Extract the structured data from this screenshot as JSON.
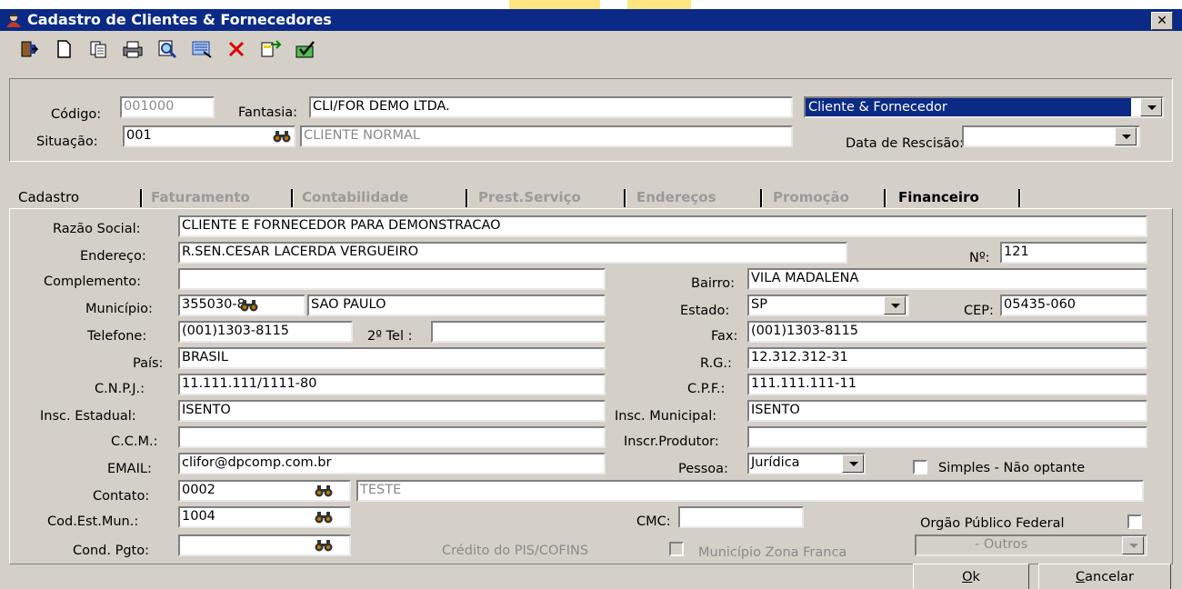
{
  "window": {
    "title": "Cadastro de Clientes & Fornecedores",
    "close_label": "✕"
  },
  "toolbar": {
    "icons": [
      "exit-icon",
      "new-icon",
      "copy-icon",
      "print-icon",
      "search-icon",
      "view-icon",
      "delete-icon",
      "transfer-icon",
      "confirm-icon"
    ]
  },
  "header": {
    "codigo_label": "Código:",
    "codigo_value": "001000",
    "fantasia_label": "Fantasia:",
    "fantasia_value": "CLI/FOR DEMO LTDA.",
    "tipo_value": "Cliente & Fornecedor",
    "situacao_label": "Situação:",
    "situacao_value": "001",
    "situacao_desc": "CLIENTE NORMAL",
    "rescisao_label": "Data de Rescisão:",
    "rescisao_value": ""
  },
  "tabs": [
    {
      "label": "Cadastro"
    },
    {
      "label": "Faturamento"
    },
    {
      "label": "Contabilidade"
    },
    {
      "label": "Prest.Serviço"
    },
    {
      "label": "Endereços"
    },
    {
      "label": "Promoção"
    },
    {
      "label": "Financeiro"
    }
  ],
  "form": {
    "razao_label": "Razão Social:",
    "razao_value": "CLIENTE E FORNECEDOR PARA DEMONSTRACAO",
    "endereco_label": "Endereço:",
    "endereco_value": "R.SEN.CESAR LACERDA VERGUEIRO",
    "numero_label": "Nº:",
    "numero_value": "121",
    "complemento_label": "Complemento:",
    "complemento_value": "",
    "bairro_label": "Bairro:",
    "bairro_value": "VILA MADALENA",
    "municipio_label": "Município:",
    "municipio_code": "355030-8",
    "municipio_name": "SAO PAULO",
    "estado_label": "Estado:",
    "estado_value": "SP",
    "cep_label": "CEP:",
    "cep_value": "05435-060",
    "telefone_label": "Telefone:",
    "telefone_value": "(001)1303-8115",
    "tel2_label": "2º Tel :",
    "tel2_value": "",
    "fax_label": "Fax:",
    "fax_value": "(001)1303-8115",
    "pais_label": "País:",
    "pais_value": "BRASIL",
    "rg_label": "R.G.:",
    "rg_value": "12.312.312-31",
    "cnpj_label": "C.N.P.J.:",
    "cnpj_value": "11.111.111/1111-80",
    "cpf_label": "C.P.F.:",
    "cpf_value": "111.111.111-11",
    "ie_label": "Insc. Estadual:",
    "ie_value": "ISENTO",
    "im_label": "Insc. Municipal:",
    "im_value": "ISENTO",
    "ccm_label": "C.C.M.:",
    "ccm_value": "",
    "produtor_label": "Inscr.Produtor:",
    "produtor_value": "",
    "email_label": "EMAIL:",
    "email_value": "clifor@dpcomp.com.br",
    "pessoa_label": "Pessoa:",
    "pessoa_value": "Jurídica",
    "simples_label": "Simples - Não optante",
    "contato_label": "Contato:",
    "contato_code": "0002",
    "contato_name": "TESTE",
    "codest_label": "Cod.Est.Mun.:",
    "codest_value": "1004",
    "cmc_label": "CMC:",
    "cmc_value": "",
    "orgao_label": "Orgão Público Federal",
    "condpgto_label": "Cond. Pgto:",
    "condpgto_value": "",
    "pis_label": "Crédito do PIS/COFINS",
    "zf_label": "Município Zona Franca",
    "zf_value": "- Outros"
  },
  "buttons": {
    "ok_hotkey": "O",
    "ok_rest": "k",
    "cancel_hotkey": "C",
    "cancel_rest": "ancelar"
  },
  "colors": {
    "titlebar": "#0b2a85",
    "selection": "#0b2a85",
    "face": "#d4d0c8"
  }
}
